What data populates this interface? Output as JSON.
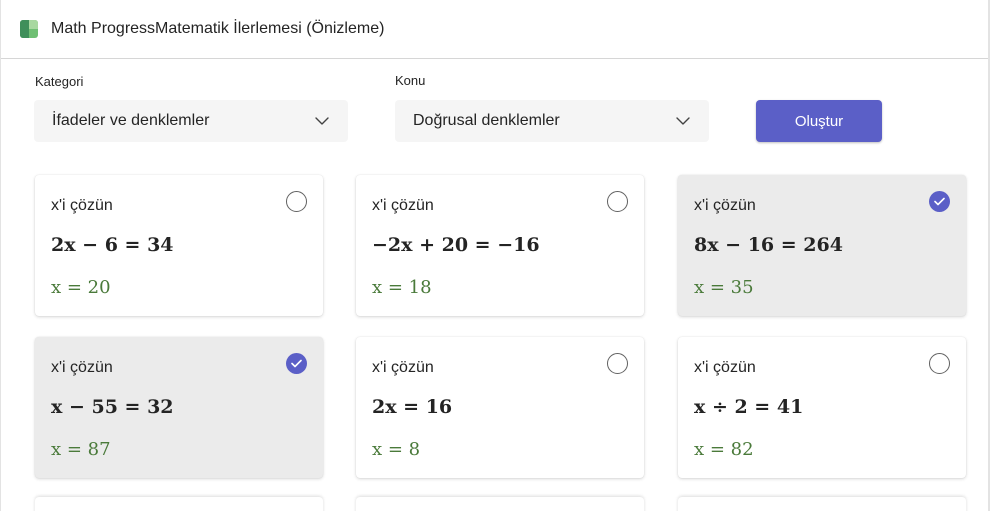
{
  "window": {
    "title": "Math ProgressMatematik İlerlemesi (Önizleme)"
  },
  "filters": {
    "category": {
      "label": "Kategori",
      "value": "İfadeler ve denklemler"
    },
    "topic": {
      "label": "Konu",
      "value": "Doğrusal denklemler"
    },
    "create_label": "Oluştur"
  },
  "colors": {
    "accent": "#5b5fc7",
    "answer": "#4a7a3a",
    "selected_card": "#ebebeb"
  },
  "cards": [
    {
      "prompt": "x'i çözün",
      "equation": "2x − 6 = 34",
      "answer": "x = 20",
      "selected": false
    },
    {
      "prompt": "x'i çözün",
      "equation": "−2x + 20 = −16",
      "answer": "x = 18",
      "selected": false
    },
    {
      "prompt": "x'i çözün",
      "equation": "8x − 16 = 264",
      "answer": "x = 35",
      "selected": true
    },
    {
      "prompt": "x'i çözün",
      "equation": "x − 55 = 32",
      "answer": "x = 87",
      "selected": true
    },
    {
      "prompt": "x'i çözün",
      "equation": "2x = 16",
      "answer": "x = 8",
      "selected": false
    },
    {
      "prompt": "x'i çözün",
      "equation": "x ÷ 2 = 41",
      "answer": "x = 82",
      "selected": false
    }
  ]
}
